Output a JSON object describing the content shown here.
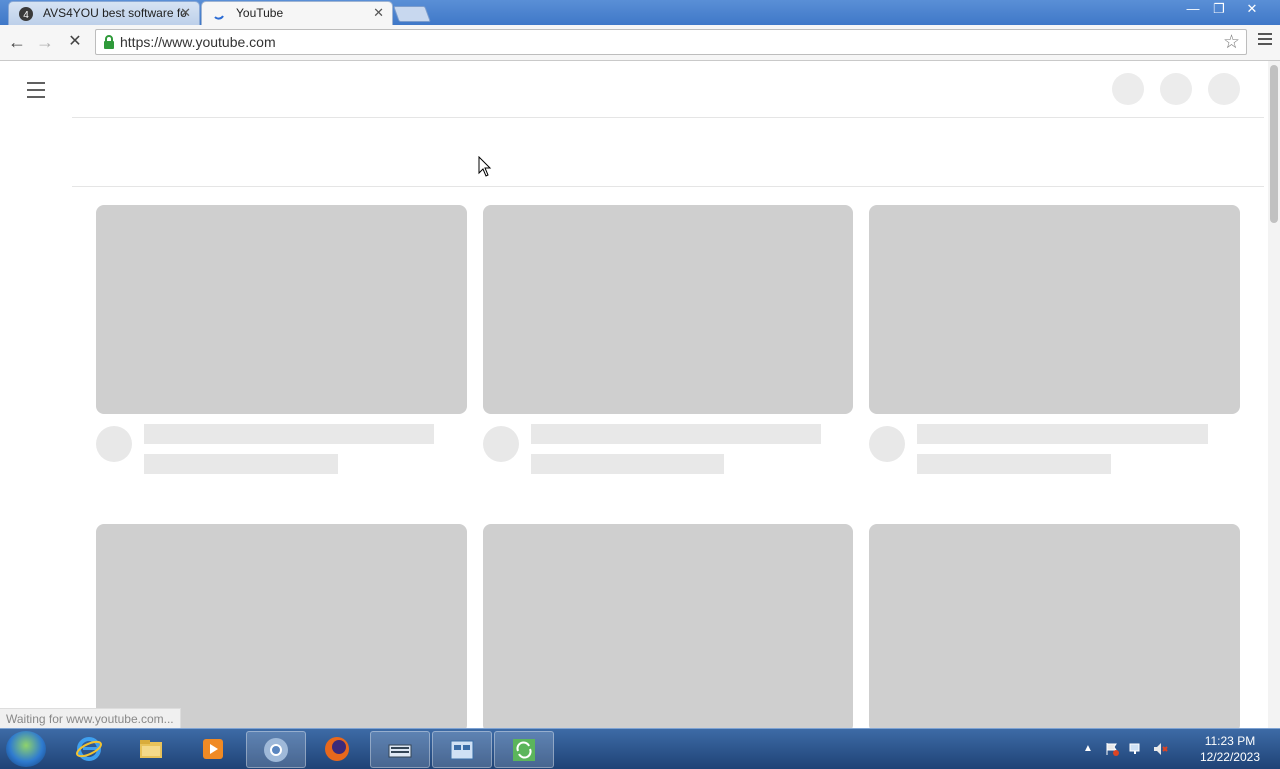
{
  "browser": {
    "tabs": [
      {
        "title": "AVS4YOU best software fo",
        "active": false
      },
      {
        "title": "YouTube",
        "active": true
      }
    ],
    "address": "https://www.youtube.com",
    "window_buttons": {
      "minimize": "—",
      "restore": "❐",
      "close": "✕"
    },
    "nav": {
      "back": "←",
      "forward": "→",
      "stop": "✕"
    },
    "status": "Waiting for www.youtube.com..."
  },
  "taskbar": {
    "apps": [
      "internet-explorer-icon",
      "file-explorer-icon",
      "media-player-icon",
      "chrome-icon",
      "firefox-icon",
      "on-screen-keyboard-icon",
      "control-panel-icon",
      "sync-tool-icon"
    ],
    "time": "11:23 PM",
    "date": "12/22/2023"
  },
  "colors": {
    "skeleton_thumb": "#cfcfcf",
    "skeleton_text": "#e8e8e8",
    "taskbar": "#2b5591"
  }
}
